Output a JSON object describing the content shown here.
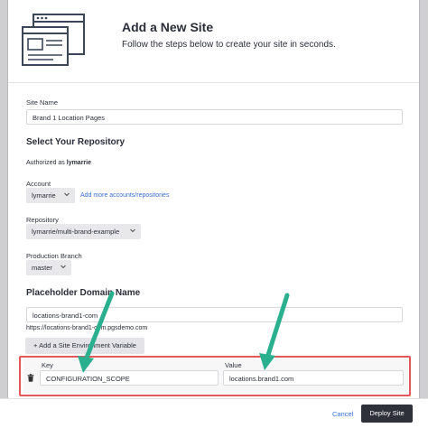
{
  "header": {
    "title": "Add a New Site",
    "subtitle": "Follow the steps below to create your site in seconds."
  },
  "site_name": {
    "label": "Site Name",
    "value": "Brand 1 Location Pages"
  },
  "repository_section": {
    "title": "Select Your Repository",
    "authorized_prefix": "Authorized as ",
    "authorized_user": "lymarrie",
    "account_label": "Account",
    "account_value": "lymarrie",
    "add_accounts_link": "Add more accounts/repositories",
    "repository_label": "Repository",
    "repository_value": "lymarrie/multi-brand-example",
    "branch_label": "Production Branch",
    "branch_value": "master"
  },
  "domain_section": {
    "title": "Placeholder Domain Name",
    "input_value": "locations-brand1-com",
    "url_preview": "https://locations-brand1-com.pgsdemo.com"
  },
  "env_vars": {
    "add_button": "+ Add a Site Environment Variable",
    "key_label": "Key",
    "key_value": "CONFIGURATION_SCOPE",
    "value_label": "Value",
    "value_value": "locations.brand1.com"
  },
  "footer": {
    "cancel": "Cancel",
    "deploy": "Deploy Site"
  },
  "colors": {
    "link": "#3a6fd8",
    "highlight": "#e4585a",
    "arrow": "#2bb08f",
    "primary_button": "#2e303a"
  },
  "icons": [
    "browser-window-illustration-icon",
    "chevron-down-icon",
    "trash-icon",
    "annotation-arrow-icon"
  ]
}
